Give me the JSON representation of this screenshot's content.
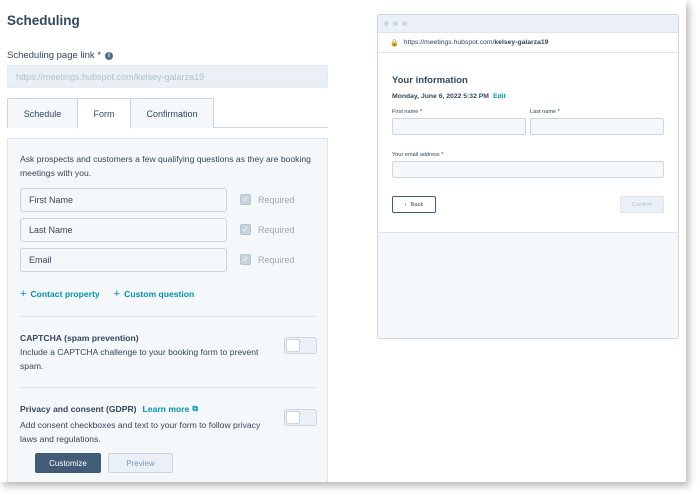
{
  "page": {
    "title": "Scheduling"
  },
  "scheduling_link": {
    "label": "Scheduling page link *",
    "info_icon": "info-icon",
    "value": "https://meetings.hubspot.com/kelsey-galarza19"
  },
  "tabs": [
    {
      "label": "Schedule",
      "active": false
    },
    {
      "label": "Form",
      "active": true
    },
    {
      "label": "Confirmation",
      "active": false
    }
  ],
  "form": {
    "intro": "Ask prospects and customers a few qualifying questions as they are booking meetings with you.",
    "fields": [
      {
        "label": "First Name",
        "required_label": "Required",
        "required": true
      },
      {
        "label": "Last Name",
        "required_label": "Required",
        "required": true
      },
      {
        "label": "Email",
        "required_label": "Required",
        "required": true
      }
    ],
    "add_contact_property": "Contact property",
    "add_custom_question": "Custom question",
    "captcha": {
      "title": "CAPTCHA (spam prevention)",
      "description": "Include a CAPTCHA challenge to your booking form to prevent spam.",
      "enabled": false
    },
    "gdpr": {
      "title": "Privacy and consent (GDPR)",
      "learn_more": "Learn more",
      "description": "Add consent checkboxes and text to your form to follow privacy laws and regulations.",
      "enabled": false
    },
    "customize_label": "Customize",
    "preview_label": "Preview"
  },
  "preview": {
    "url_prefix": "https://meetings.hubspot.com/",
    "url_slug": "kelsey-galarza19",
    "title": "Your information",
    "date": "Monday, June 6, 2022 5:32 PM",
    "edit_label": "Edit",
    "first_name_label": "First name *",
    "last_name_label": "Last name *",
    "email_label": "Your email address *",
    "back_label": "Back",
    "confirm_label": "Confirm"
  },
  "colors": {
    "text": "#33475b",
    "link": "#0091ae",
    "primary_button": "#425b76",
    "panel_bg": "#f5f8fa",
    "border": "#cbd6e2"
  }
}
